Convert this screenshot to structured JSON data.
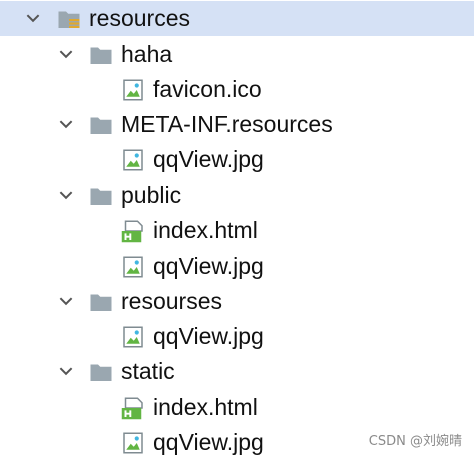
{
  "tree": {
    "root": {
      "label": "resources"
    },
    "haha": {
      "label": "haha",
      "files": [
        {
          "label": "favicon.ico"
        }
      ]
    },
    "meta_inf": {
      "label": "META-INF.resources",
      "files": [
        {
          "label": "qqView.jpg"
        }
      ]
    },
    "public": {
      "label": "public",
      "files": [
        {
          "label": "index.html"
        },
        {
          "label": "qqView.jpg"
        }
      ]
    },
    "resourses": {
      "label": "resourses",
      "files": [
        {
          "label": "qqView.jpg"
        }
      ]
    },
    "static": {
      "label": "static",
      "files": [
        {
          "label": "index.html"
        },
        {
          "label": "qqView.jpg"
        }
      ]
    }
  },
  "icons": {
    "expanded": "chevron-down-icon",
    "folder": "folder-icon",
    "resources_folder": "resources-folder-icon",
    "image_file": "image-file-icon",
    "html_file": "html-file-icon"
  },
  "colors": {
    "selection": "#d5e1f5",
    "folder": "#9aa7b0",
    "html_badge": "#62b543"
  },
  "watermark": "CSDN @刘婉晴"
}
